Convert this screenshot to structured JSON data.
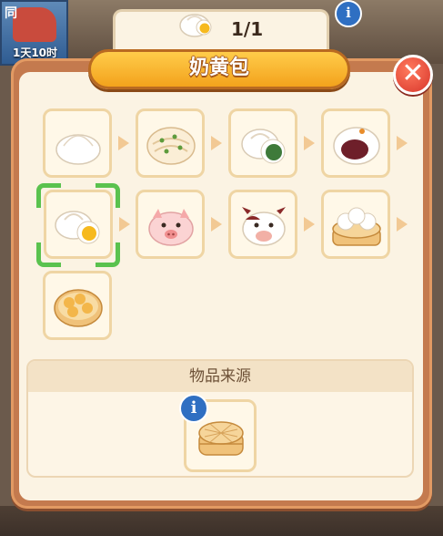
{
  "hud": {
    "time_label": "1天10时",
    "gate_char": "同",
    "info_glyph": "i"
  },
  "item": {
    "name": "奶黄包",
    "count": "1/1"
  },
  "close": {
    "glyph": "✕"
  },
  "chain": [
    {
      "id": "plain-bun",
      "icon": "plain-bun-icon"
    },
    {
      "id": "scallion-roll",
      "icon": "scallion-roll-icon"
    },
    {
      "id": "vegetable-bun",
      "icon": "vegetable-bun-icon"
    },
    {
      "id": "red-bean-bun",
      "icon": "red-bean-bun-icon"
    },
    {
      "id": "custard-bun",
      "icon": "custard-bun-icon",
      "selected": true
    },
    {
      "id": "pig-bun",
      "icon": "pig-bun-icon"
    },
    {
      "id": "cow-bun",
      "icon": "cow-bun-icon"
    },
    {
      "id": "steamer-buns",
      "icon": "steamer-buns-icon"
    },
    {
      "id": "soup-dumplings",
      "icon": "soup-dumplings-icon"
    }
  ],
  "source": {
    "title": "物品来源",
    "item_icon": "bamboo-steamer-icon",
    "info_glyph": "i"
  },
  "colors": {
    "panel": "#c47a4e",
    "title_bar": "#f3a21c",
    "selection": "#5ac24e",
    "close": "#d8362b"
  }
}
